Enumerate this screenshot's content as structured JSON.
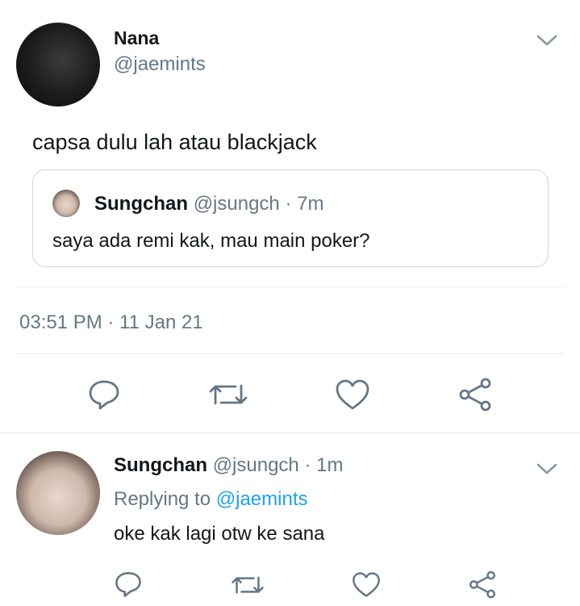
{
  "tweet": {
    "display_name": "Nana",
    "handle": "@jaemints",
    "text": "capsa dulu lah atau blackjack",
    "timestamp": "03:51 PM · 11 Jan 21",
    "quoted": {
      "display_name": "Sungchan",
      "handle": "@jsungch",
      "time": "· 7m",
      "text": "saya ada remi kak, mau main poker?"
    },
    "actions": [
      "reply-icon",
      "retweet-icon",
      "like-icon",
      "share-icon"
    ]
  },
  "reply": {
    "display_name": "Sungchan",
    "handle": "@jsungch",
    "time": "· 1m",
    "replying_to_prefix": "Replying to",
    "replying_to_handle": "@jaemints",
    "text": "oke kak lagi otw ke sana",
    "actions": [
      "reply-icon",
      "retweet-icon",
      "like-icon",
      "share-icon"
    ]
  },
  "colors": {
    "text": "#14171a",
    "secondary": "#657786",
    "link": "#1da1f2",
    "divider": "#e6ecf0"
  }
}
